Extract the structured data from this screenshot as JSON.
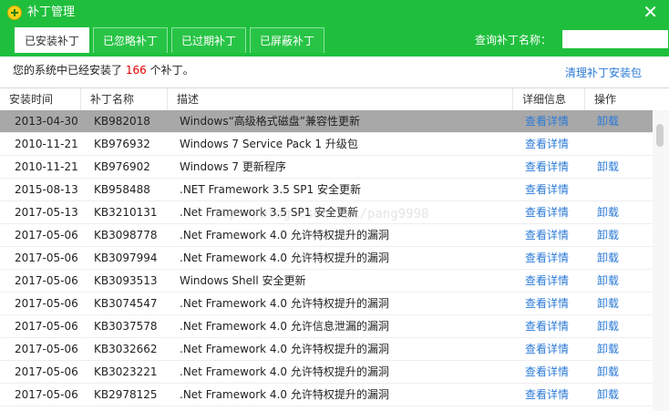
{
  "window": {
    "title": "补丁管理",
    "close_icon": "✕"
  },
  "tabs": [
    {
      "label": "已安装补丁",
      "active": true
    },
    {
      "label": "已忽略补丁",
      "active": false
    },
    {
      "label": "已过期补丁",
      "active": false
    },
    {
      "label": "已屏蔽补丁",
      "active": false
    }
  ],
  "search": {
    "label": "查询补丁名称：",
    "value": "",
    "placeholder": ""
  },
  "summary": {
    "prefix": "您的系统中已经安装了",
    "count": "166",
    "suffix": "个补丁。"
  },
  "clean_link": "清理补丁安装包",
  "columns": {
    "date": "安装时间",
    "kb": "补丁名称",
    "desc": "描述",
    "detail": "详细信息",
    "action": "操作"
  },
  "rows": [
    {
      "date": "2013-04-30",
      "kb": "KB982018",
      "desc": "Windows“高级格式磁盘”兼容性更新",
      "detail": "查看详情",
      "action": "卸载",
      "selected": true
    },
    {
      "date": "2010-11-21",
      "kb": "KB976932",
      "desc": "Windows 7 Service Pack 1 升级包",
      "detail": "查看详情",
      "action": "",
      "selected": false
    },
    {
      "date": "2010-11-21",
      "kb": "KB976902",
      "desc": "Windows 7 更新程序",
      "detail": "查看详情",
      "action": "卸载",
      "selected": false
    },
    {
      "date": "2015-08-13",
      "kb": "KB958488",
      "desc": ".NET Framework 3.5 SP1 安全更新",
      "detail": "查看详情",
      "action": "",
      "selected": false
    },
    {
      "date": "2017-05-13",
      "kb": "KB3210131",
      "desc": ".Net Framework 3.5 SP1 安全更新",
      "detail": "查看详情",
      "action": "卸载",
      "selected": false
    },
    {
      "date": "2017-05-06",
      "kb": "KB3098778",
      "desc": ".Net Framework 4.0 允许特权提升的漏洞",
      "detail": "查看详情",
      "action": "卸载",
      "selected": false
    },
    {
      "date": "2017-05-06",
      "kb": "KB3097994",
      "desc": ".Net Framework 4.0 允许特权提升的漏洞",
      "detail": "查看详情",
      "action": "卸载",
      "selected": false
    },
    {
      "date": "2017-05-06",
      "kb": "KB3093513",
      "desc": "Windows Shell 安全更新",
      "detail": "查看详情",
      "action": "卸载",
      "selected": false
    },
    {
      "date": "2017-05-06",
      "kb": "KB3074547",
      "desc": ".Net Framework 4.0 允许特权提升的漏洞",
      "detail": "查看详情",
      "action": "卸载",
      "selected": false
    },
    {
      "date": "2017-05-06",
      "kb": "KB3037578",
      "desc": ".Net Framework 4.0 允许信息泄漏的漏洞",
      "detail": "查看详情",
      "action": "卸载",
      "selected": false
    },
    {
      "date": "2017-05-06",
      "kb": "KB3032662",
      "desc": ".Net Framework 4.0 允许特权提升的漏洞",
      "detail": "查看详情",
      "action": "卸载",
      "selected": false
    },
    {
      "date": "2017-05-06",
      "kb": "KB3023221",
      "desc": ".Net Framework 4.0 允许特权提升的漏洞",
      "detail": "查看详情",
      "action": "卸载",
      "selected": false
    },
    {
      "date": "2017-05-06",
      "kb": "KB2978125",
      "desc": ".Net Framework 4.0 允许特权提升的漏洞",
      "detail": "查看详情",
      "action": "卸载",
      "selected": false
    }
  ],
  "watermark": "http://blog.csdn.net/pang9998",
  "colors": {
    "accent": "#1fbf3d",
    "link": "#2b7ad7",
    "count": "#e60000",
    "selected_row": "#a8a8a8"
  }
}
